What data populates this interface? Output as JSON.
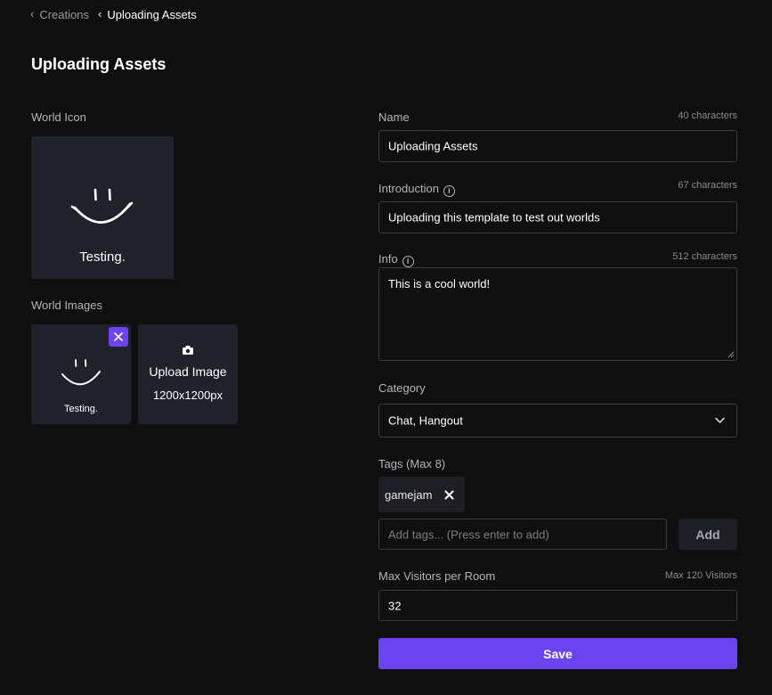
{
  "breadcrumb": {
    "parent": "Creations",
    "current": "Uploading Assets"
  },
  "page_title": "Uploading Assets",
  "world_icon": {
    "label": "World Icon",
    "caption": "Testing."
  },
  "world_images": {
    "label": "World Images",
    "images": [
      {
        "caption": "Testing.",
        "remove_icon": "close-icon"
      }
    ],
    "upload": {
      "icon": "camera-icon",
      "label": "Upload Image",
      "size": "1200x1200px"
    }
  },
  "name": {
    "label": "Name",
    "limit": "40 characters",
    "value": "Uploading Assets"
  },
  "introduction": {
    "label": "Introduction",
    "limit": "67 characters",
    "value": "Uploading this template to test out worlds"
  },
  "info": {
    "label": "Info",
    "limit": "512 characters",
    "value": "This is a cool world!"
  },
  "category": {
    "label": "Category",
    "value": "Chat, Hangout"
  },
  "tags": {
    "label": "Tags (Max 8)",
    "items": [
      "gamejam"
    ],
    "placeholder": "Add tags... (Press enter to add)",
    "add_label": "Add"
  },
  "max_visitors": {
    "label": "Max Visitors per Room",
    "limit": "Max 120 Visitors",
    "value": "32"
  },
  "save_label": "Save",
  "colors": {
    "accent": "#6b44f0",
    "background": "#0f0f10",
    "tile": "#1f222a"
  }
}
